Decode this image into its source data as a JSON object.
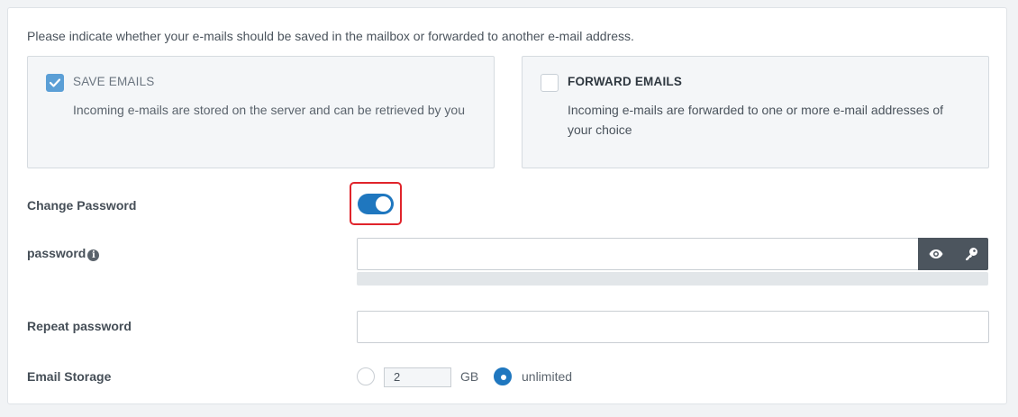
{
  "intro": "Please indicate whether your e-mails should be saved in the mailbox or forwarded to another e-mail address.",
  "options": {
    "save": {
      "title": "SAVE EMAILS",
      "description": "Incoming e-mails are stored on the server and can be retrieved by you",
      "checked": true
    },
    "forward": {
      "title": "FORWARD EMAILS",
      "description": "Incoming e-mails are forwarded to one or more e-mail addresses of your choice",
      "checked": false
    }
  },
  "change_password": {
    "label": "Change Password",
    "enabled": true
  },
  "password": {
    "label": "password",
    "value": "",
    "show_icon": "eye-icon",
    "generate_icon": "key-icon"
  },
  "repeat_password": {
    "label": "Repeat password",
    "value": ""
  },
  "email_storage": {
    "label": "Email Storage",
    "amount": "2",
    "unit": "GB",
    "unlimited_label": "unlimited",
    "selected": "unlimited"
  },
  "colors": {
    "accent": "#1f77bf",
    "highlight": "#e0242b",
    "checkbox": "#5b9fd6"
  }
}
